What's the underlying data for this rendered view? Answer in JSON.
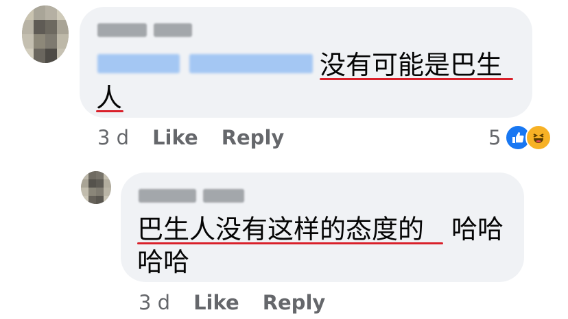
{
  "comment": {
    "text_line1": "没有可能是巴生",
    "text_line2": "人",
    "time": "3 d",
    "like_label": "Like",
    "reply_label": "Reply",
    "reaction_count": "5",
    "reactions": [
      "like-reaction-icon",
      "haha-reaction-icon"
    ]
  },
  "reply": {
    "text_line1_underlined": "巴生人没有这样的态度的",
    "text_line1_rest": "哈哈",
    "text_line2": "哈哈",
    "time": "3 d",
    "like_label": "Like",
    "reply_label": "Reply"
  },
  "colors": {
    "bubble": "#f0f2f5",
    "underline": "#d9202a",
    "meta_text": "#65676b",
    "like_blue": "#1877f2",
    "haha_yellow": "#f7b125"
  }
}
